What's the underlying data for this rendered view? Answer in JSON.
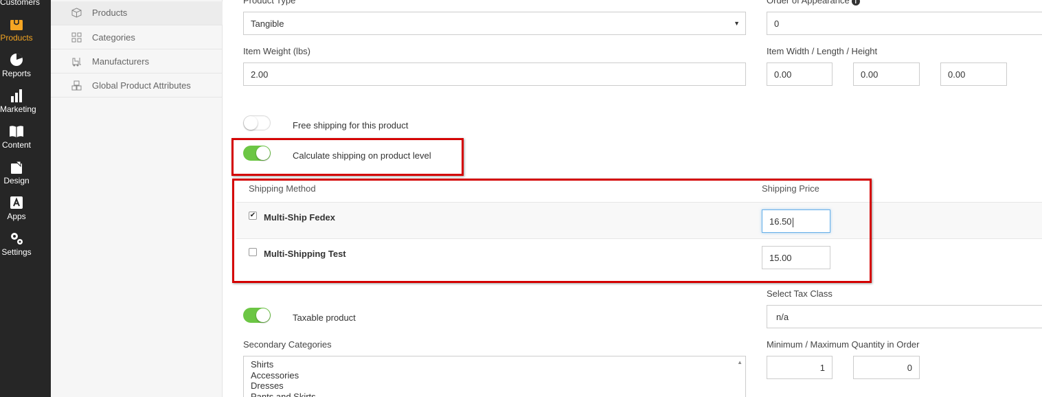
{
  "nav": {
    "items": [
      {
        "label": "Customers",
        "icon": "customers-icon"
      },
      {
        "label": "Products",
        "icon": "products-icon",
        "active": true
      },
      {
        "label": "Reports",
        "icon": "reports-icon"
      },
      {
        "label": "Marketing",
        "icon": "marketing-icon"
      },
      {
        "label": "Content",
        "icon": "content-icon"
      },
      {
        "label": "Design",
        "icon": "design-icon"
      },
      {
        "label": "Apps",
        "icon": "apps-icon"
      },
      {
        "label": "Settings",
        "icon": "settings-icon"
      }
    ],
    "active_color": "#f5a623"
  },
  "submenu": {
    "items": [
      {
        "label": "Products",
        "icon": "box-icon"
      },
      {
        "label": "Categories",
        "icon": "grid-icon"
      },
      {
        "label": "Manufacturers",
        "icon": "forklift-icon"
      },
      {
        "label": "Global Product Attributes",
        "icon": "boxes-icon"
      }
    ]
  },
  "form": {
    "product_type": {
      "label": "Product Type",
      "value": "Tangible"
    },
    "order_of_appearance": {
      "label": "Order of Appearance",
      "value": "0"
    },
    "item_weight": {
      "label": "Item Weight (lbs)",
      "value": "2.00"
    },
    "dimensions": {
      "label": "Item Width / Length / Height",
      "width": "0.00",
      "length": "0.00",
      "height": "0.00"
    },
    "free_shipping": {
      "label": "Free shipping for this product",
      "on": false
    },
    "calc_shipping": {
      "label": "Calculate shipping on product level",
      "on": true
    },
    "shipping_table": {
      "method_header": "Shipping Method",
      "price_header": "Shipping Price",
      "rows": [
        {
          "name": "Multi-Ship Fedex",
          "checked": true,
          "price": "16.50"
        },
        {
          "name": "Multi-Shipping Test",
          "checked": false,
          "price": "15.00"
        }
      ]
    },
    "taxable": {
      "label": "Taxable product",
      "on": true
    },
    "tax_class": {
      "label": "Select Tax Class",
      "value": "n/a"
    },
    "secondary_categories": {
      "label": "Secondary Categories",
      "options": [
        "Shirts",
        "Accessories",
        "Dresses",
        "Pants and Skirts"
      ]
    },
    "min_max_qty": {
      "label": "Minimum / Maximum Quantity in Order",
      "min": "1",
      "max": "0"
    }
  },
  "colors": {
    "toggle_on": "#6cc644",
    "highlight": "#d40000",
    "focus": "#66afe9"
  }
}
